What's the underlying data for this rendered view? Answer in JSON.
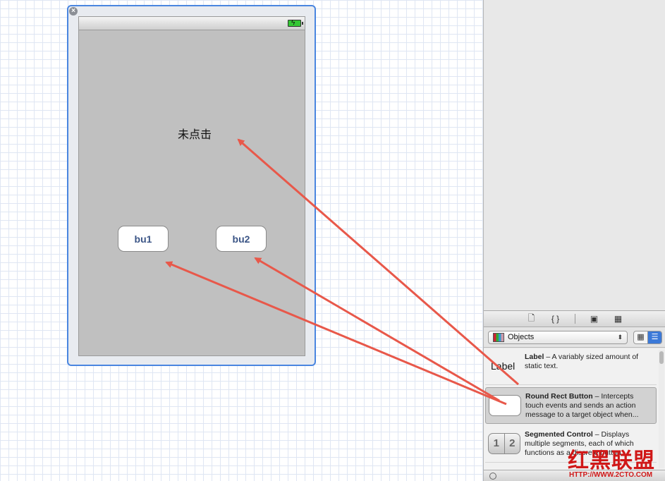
{
  "canvas": {
    "view_controller": {
      "close_badge": "×",
      "status_label": "未点击",
      "buttons": [
        {
          "label": "bu1"
        },
        {
          "label": "bu2"
        }
      ]
    }
  },
  "library": {
    "tab_icons": [
      "file-icon",
      "code-braces-icon",
      "cube-icon",
      "grid-icon"
    ],
    "tab_glyphs": [
      "🗋",
      "{ }",
      "▣",
      "▦"
    ],
    "filter": {
      "selected": "Objects"
    },
    "view_toggle": {
      "grid_glyph": "▦",
      "list_glyph": "☰"
    },
    "items": [
      {
        "thumb": "Label",
        "name": "Label",
        "desc": " – A variably sized amount of static text."
      },
      {
        "thumb": "",
        "name": "Round Rect Button",
        "desc": " – Intercepts touch events and sends an action message to a target object when..."
      },
      {
        "thumb_segments": [
          "1",
          "2"
        ],
        "name": "Segmented Control",
        "desc": " – Displays multiple segments, each of which functions as a discrete button."
      }
    ]
  },
  "watermark": {
    "brand": "红黑联盟",
    "url": "HTTP://WWW.2CTO.COM"
  },
  "colors": {
    "arrow": "#e8584a",
    "frame_border": "#4a86e0",
    "view_bg": "#c0c0c0"
  }
}
